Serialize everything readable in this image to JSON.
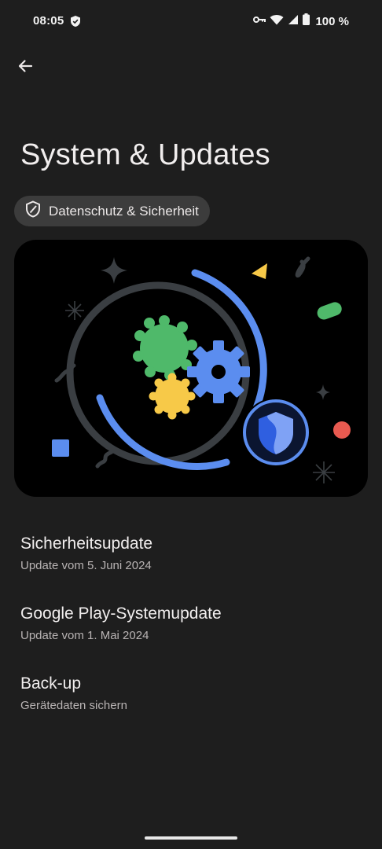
{
  "status_bar": {
    "time": "08:05",
    "battery": "100 %",
    "icons": [
      "shield-icon",
      "key-icon",
      "wifi-icon",
      "signal-icon",
      "battery-icon"
    ]
  },
  "header": {
    "back_icon": "arrow-left-icon",
    "title": "System & Updates"
  },
  "chip": {
    "icon": "shield-icon",
    "label": "Datenschutz & Sicherheit"
  },
  "hero": {
    "illustration": "gears-and-shield-illustration",
    "colors": {
      "blue": "#5b8def",
      "green": "#4fb96a",
      "yellow": "#f7c948",
      "red": "#e85a50",
      "ring": "#3a3e42"
    }
  },
  "items": [
    {
      "title": "Sicherheitsupdate",
      "subtitle": "Update vom 5. Juni 2024"
    },
    {
      "title": "Google Play-Systemupdate",
      "subtitle": "Update vom 1. Mai 2024"
    },
    {
      "title": "Back-up",
      "subtitle": "Gerätedaten sichern"
    }
  ],
  "theme": {
    "background": "#1e1e1e",
    "chip_bg": "#3c3c3c",
    "text": "#f1eeee",
    "subtext": "#b9b4b4"
  }
}
